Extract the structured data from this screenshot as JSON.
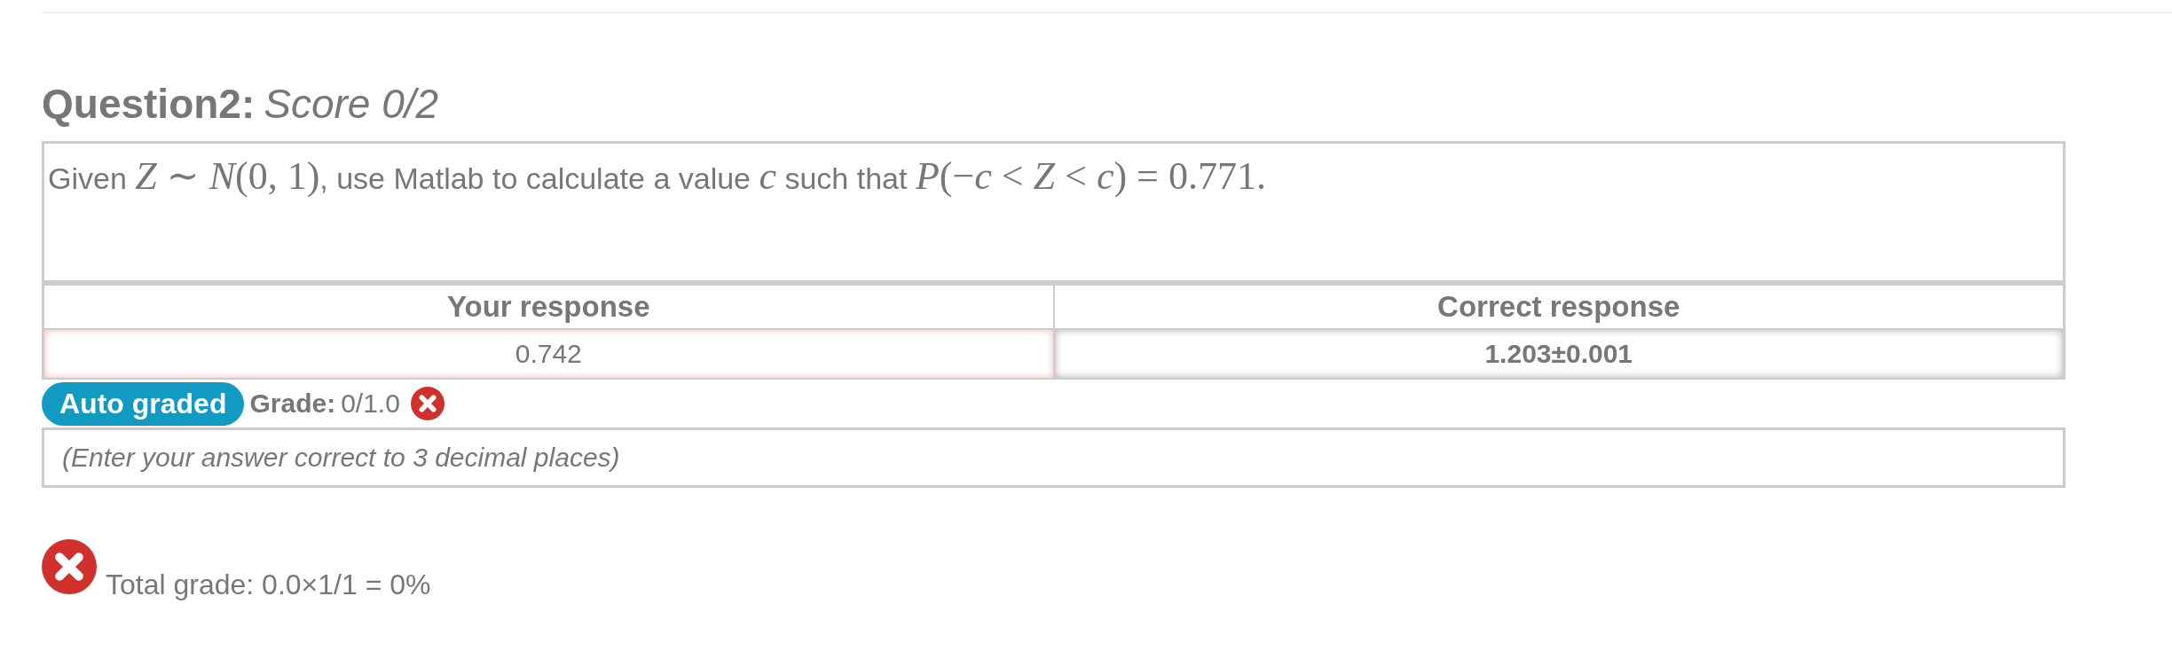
{
  "question": {
    "title": "Question2:",
    "score": "Score 0/2",
    "prompt": [
      {
        "kind": "text",
        "text": "Given "
      },
      {
        "kind": "math",
        "text": "*Z* ∼ *N*(0, 1)"
      },
      {
        "kind": "text",
        "text": ", use Matlab to calculate a value "
      },
      {
        "kind": "math",
        "text": "*c*"
      },
      {
        "kind": "text",
        "text": " such that "
      },
      {
        "kind": "math",
        "text": "*P*(−*c* < *Z* < *c*) = 0.771."
      }
    ]
  },
  "responses": {
    "columns": [
      "Your response",
      "Correct response"
    ],
    "values": [
      {
        "text": "0.742",
        "kind": "student",
        "correct": false
      },
      {
        "text": "1.203±0.001",
        "kind": "answer",
        "correct": true
      }
    ]
  },
  "grading": {
    "badge": "Auto graded",
    "label": "Grade:",
    "value": "0/1.0",
    "correct": false
  },
  "hint": "(Enter your answer correct to 3 decimal places)",
  "total": {
    "text": "Total grade: 0.0×1/1 = 0%",
    "correct": false
  }
}
